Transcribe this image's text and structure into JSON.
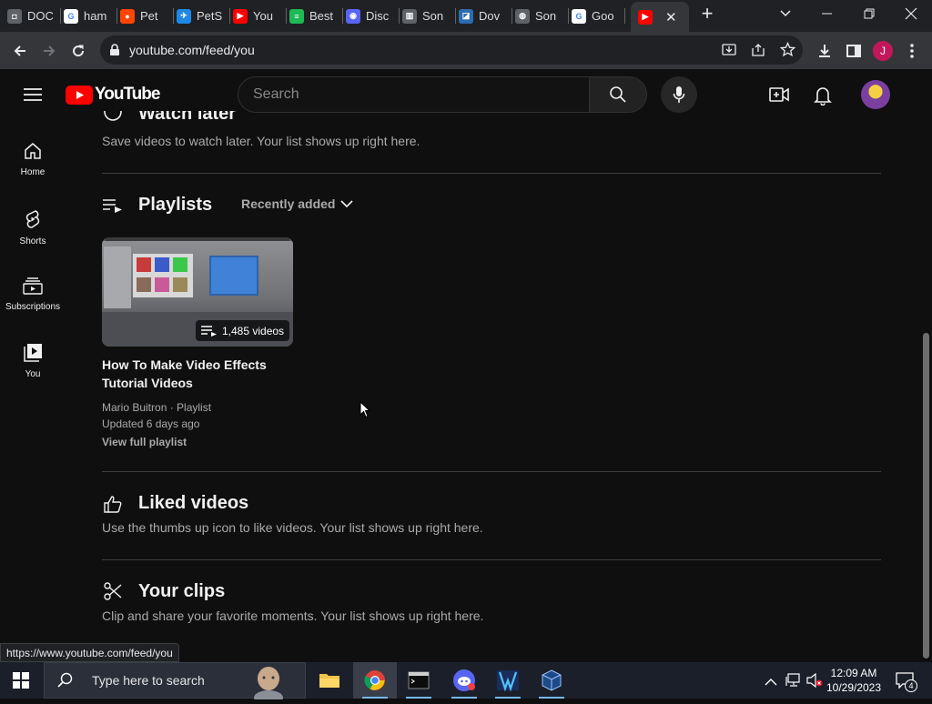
{
  "browser": {
    "tabs": [
      {
        "label": "DOC",
        "color": "#5f6368",
        "glyph": "◘"
      },
      {
        "label": "ham",
        "color": "#ffffff",
        "glyph": "G"
      },
      {
        "label": "Pet",
        "color": "#ff4500",
        "glyph": "●"
      },
      {
        "label": "PetS",
        "color": "#1e88e5",
        "glyph": "✈"
      },
      {
        "label": "You",
        "color": "#ff0000",
        "glyph": "▶"
      },
      {
        "label": "Best",
        "color": "#1db954",
        "glyph": "≡"
      },
      {
        "label": "Disc",
        "color": "#5865f2",
        "glyph": "◉"
      },
      {
        "label": "Son",
        "color": "#5f6368",
        "glyph": "▥"
      },
      {
        "label": "Dov",
        "color": "#2b6cb0",
        "glyph": "◪"
      },
      {
        "label": "Son",
        "color": "#5f6368",
        "glyph": "◍"
      },
      {
        "label": "Goo",
        "color": "#ffffff",
        "glyph": "G"
      }
    ],
    "active_tab_glyph": "▶",
    "url": "youtube.com/feed/you",
    "profile_letter": "J",
    "status_url": "https://www.youtube.com/feed/you"
  },
  "youtube": {
    "logo_text": "YouTube",
    "search_placeholder": "Search",
    "sidebar": [
      {
        "label": "Home"
      },
      {
        "label": "Shorts"
      },
      {
        "label": "Subscriptions"
      },
      {
        "label": "You"
      }
    ],
    "watch_later": {
      "title": "Watch later",
      "desc": "Save videos to watch later. Your list shows up right here."
    },
    "playlists": {
      "title": "Playlists",
      "sort_label": "Recently added",
      "item": {
        "count_label": "1,485 videos",
        "title_line1": "How To Make Video Effects",
        "title_line2": "Tutorial Videos",
        "meta": "Mario Buitron · Playlist",
        "updated": "Updated 6 days ago",
        "view_full": "View full playlist"
      }
    },
    "liked": {
      "title": "Liked videos",
      "desc": "Use the thumbs up icon to like videos. Your list shows up right here."
    },
    "clips": {
      "title": "Your clips",
      "desc": "Clip and share your favorite moments. Your list shows up right here."
    }
  },
  "taskbar": {
    "search_placeholder": "Type here to search",
    "time": "12:09 AM",
    "date": "10/29/2023",
    "notification_count": "4"
  }
}
